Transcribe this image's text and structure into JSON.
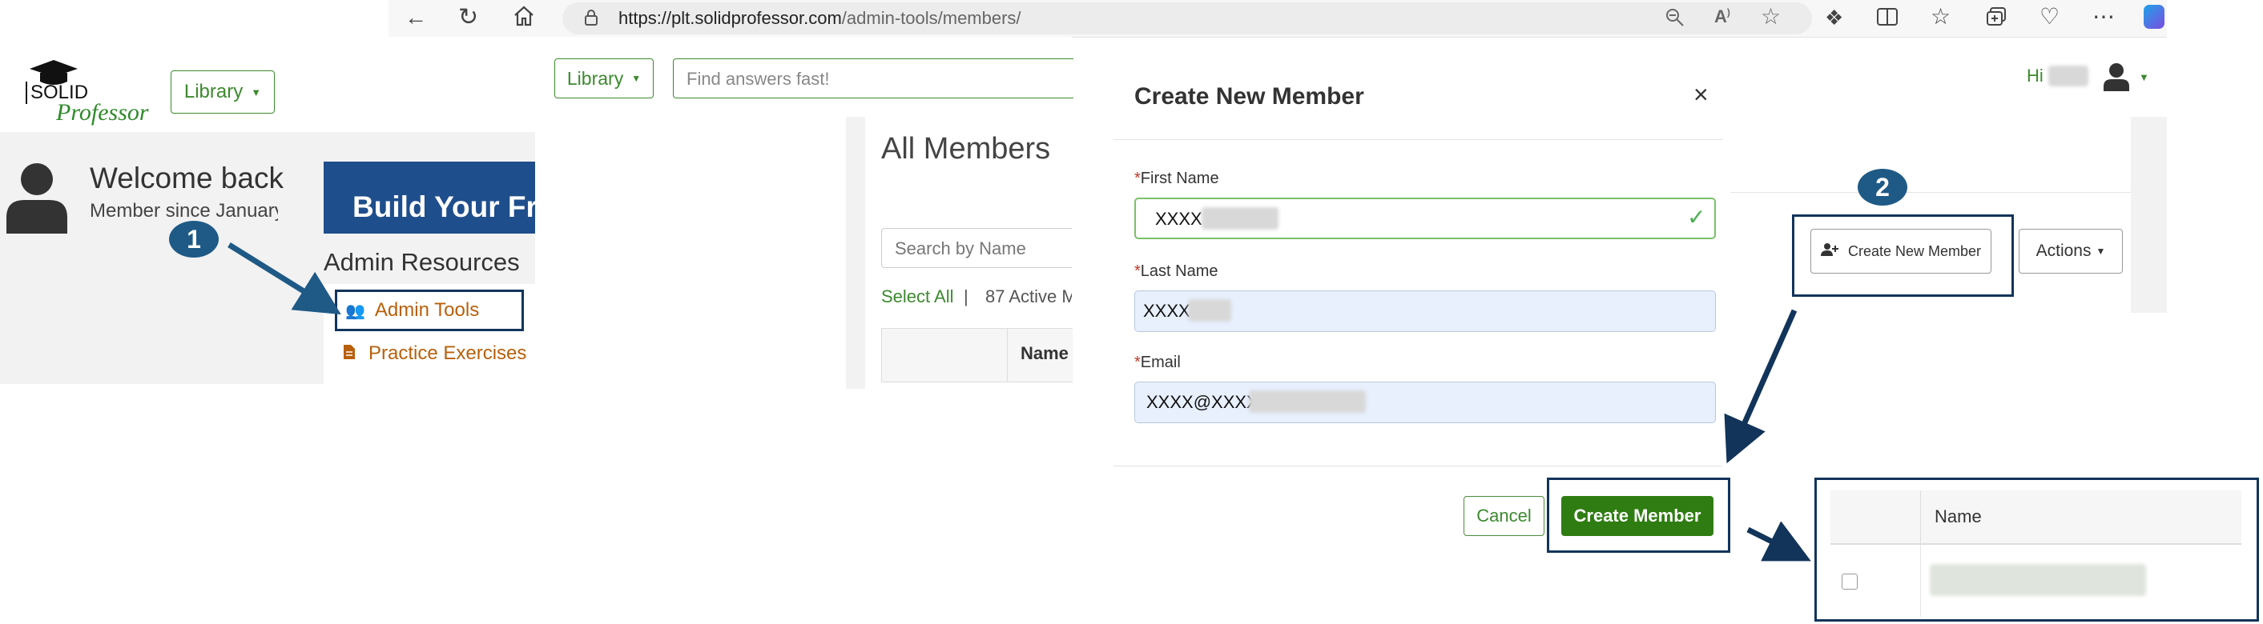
{
  "browser": {
    "url_host": "https://plt.solidprofessor.com",
    "url_path": "/admin-tools/members/"
  },
  "logo": {
    "top": "SOLID",
    "bottom": "Professor"
  },
  "nav": {
    "library_label": "Library",
    "search_placeholder": "Find answers fast!",
    "greeting": "Hi"
  },
  "dashboard": {
    "welcome": "Welcome back",
    "member_since": "Member since January",
    "banner": "Build Your Fre",
    "admin_resources": "Admin Resources",
    "admin_tools": "Admin Tools",
    "practice_exercises": "Practice Exercises"
  },
  "members": {
    "title": "All Members",
    "search_placeholder": "Search by Name",
    "select_all": "Select All",
    "separator": "|",
    "active_count": "87 Active M",
    "col_name": "Name",
    "create_button": "Create New Member",
    "actions_button": "Actions"
  },
  "modal": {
    "title": "Create New Member",
    "close": "×",
    "required_mark": "*",
    "first_name_label": "First Name",
    "first_name_value": "XXXX",
    "last_name_label": "Last Name",
    "last_name_value": "XXXX",
    "email_label": "Email",
    "email_value": "XXXX@XXXX",
    "cancel": "Cancel",
    "submit": "Create Member"
  },
  "result_table": {
    "col_name": "Name"
  },
  "steps": {
    "one": "1",
    "two": "2"
  },
  "colors": {
    "brand_green": "#3c8a2e",
    "submit_green": "#2f7d12",
    "badge_blue": "#1f5a86",
    "box_navy": "#12345a",
    "banner_blue": "#1f4e8c",
    "admin_orange": "#b8600b"
  }
}
